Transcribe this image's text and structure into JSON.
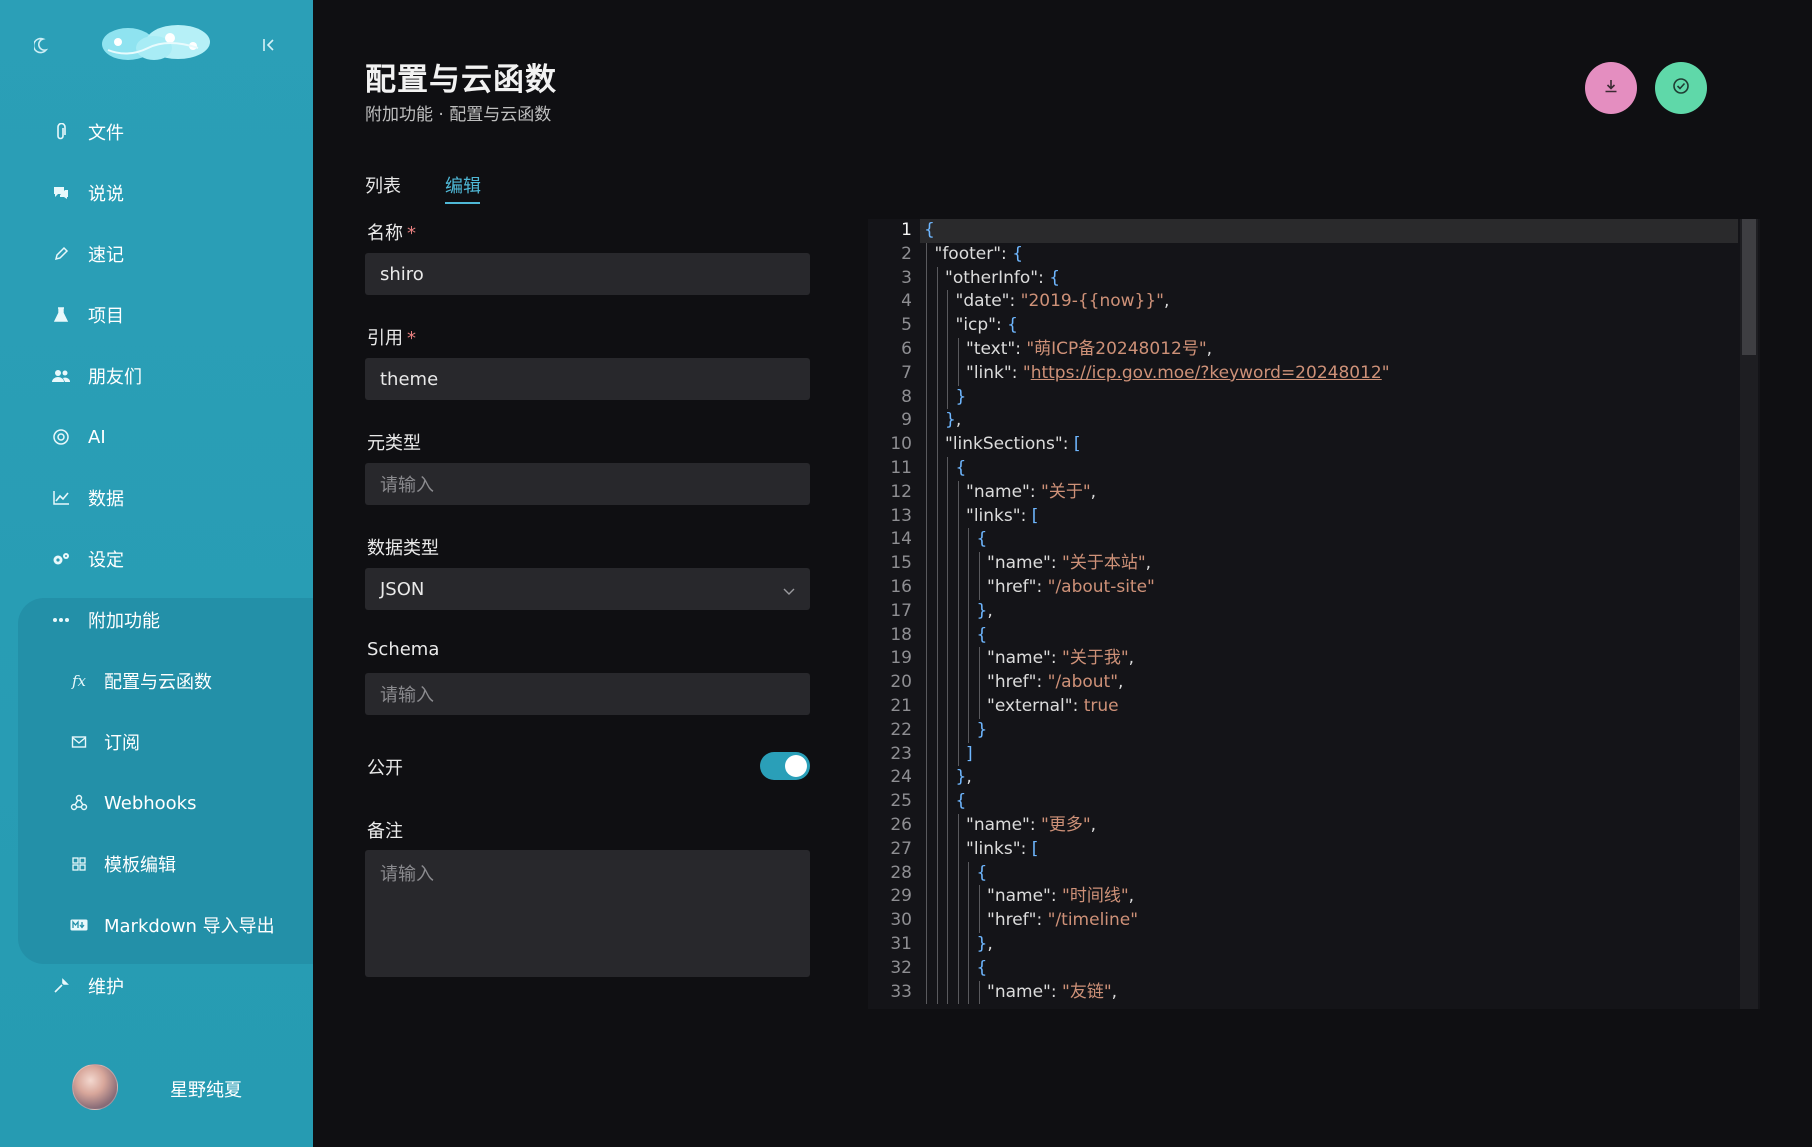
{
  "sidebar": {
    "items": [
      {
        "label": "文件",
        "icon": "paperclip-icon"
      },
      {
        "label": "说说",
        "icon": "chat-icon"
      },
      {
        "label": "速记",
        "icon": "pencil-icon"
      },
      {
        "label": "项目",
        "icon": "flask-icon"
      },
      {
        "label": "朋友们",
        "icon": "people-icon"
      },
      {
        "label": "AI",
        "icon": "ai-icon"
      },
      {
        "label": "数据",
        "icon": "chart-icon"
      },
      {
        "label": "设定",
        "icon": "gears-icon"
      },
      {
        "label": "附加功能",
        "icon": "more-icon"
      }
    ],
    "sub_items": [
      {
        "label": "配置与云函数",
        "icon": "function-icon"
      },
      {
        "label": "订阅",
        "icon": "mail-icon"
      },
      {
        "label": "Webhooks",
        "icon": "webhook-icon"
      },
      {
        "label": "模板编辑",
        "icon": "grid-icon"
      },
      {
        "label": "Markdown 导入导出",
        "icon": "markdown-icon"
      }
    ],
    "maintain": {
      "label": "维护",
      "icon": "wrench-icon"
    },
    "user": {
      "name": "星野纯夏"
    }
  },
  "header": {
    "title": "配置与云函数",
    "breadcrumb": "附加功能 · 配置与云函数"
  },
  "tabs": [
    {
      "label": "列表",
      "active": false
    },
    {
      "label": "编辑",
      "active": true
    }
  ],
  "form": {
    "name_label": "名称",
    "name_value": "shiro",
    "ref_label": "引用",
    "ref_value": "theme",
    "meta_label": "元类型",
    "meta_placeholder": "请输入",
    "datatype_label": "数据类型",
    "datatype_value": "JSON",
    "schema_label": "Schema",
    "schema_placeholder": "请输入",
    "public_label": "公开",
    "public_on": true,
    "remark_label": "备注",
    "remark_placeholder": "请输入",
    "required_mark": "*"
  },
  "editor": {
    "line_numbers": [
      "1",
      "2",
      "3",
      "4",
      "5",
      "6",
      "7",
      "8",
      "9",
      "10",
      "11",
      "12",
      "13",
      "14",
      "15",
      "16",
      "17",
      "18",
      "19",
      "20",
      "21",
      "22",
      "23",
      "24",
      "25",
      "26",
      "27",
      "28",
      "29",
      "30",
      "31",
      "32",
      "33"
    ],
    "lines": [
      {
        "indent": 0,
        "parts": [
          [
            "b",
            "{"
          ]
        ]
      },
      {
        "indent": 1,
        "parts": [
          [
            "k",
            "\"footer\""
          ],
          [
            "k",
            ": "
          ],
          [
            "b",
            "{"
          ]
        ]
      },
      {
        "indent": 2,
        "parts": [
          [
            "k",
            "\"otherInfo\""
          ],
          [
            "k",
            ": "
          ],
          [
            "b",
            "{"
          ]
        ]
      },
      {
        "indent": 3,
        "parts": [
          [
            "k",
            "\"date\""
          ],
          [
            "k",
            ": "
          ],
          [
            "s",
            "\"2019-{{now}}\""
          ],
          [
            "k",
            ","
          ]
        ]
      },
      {
        "indent": 3,
        "parts": [
          [
            "k",
            "\"icp\""
          ],
          [
            "k",
            ": "
          ],
          [
            "b",
            "{"
          ]
        ]
      },
      {
        "indent": 4,
        "parts": [
          [
            "k",
            "\"text\""
          ],
          [
            "k",
            ": "
          ],
          [
            "s",
            "\"萌ICP备20248012号\""
          ],
          [
            "k",
            ","
          ]
        ]
      },
      {
        "indent": 4,
        "parts": [
          [
            "k",
            "\"link\""
          ],
          [
            "k",
            ": "
          ],
          [
            "s",
            "\""
          ],
          [
            "link",
            "https://icp.gov.moe/?keyword=20248012"
          ],
          [
            "s",
            "\""
          ]
        ]
      },
      {
        "indent": 3,
        "parts": [
          [
            "b",
            "}"
          ]
        ]
      },
      {
        "indent": 2,
        "parts": [
          [
            "b",
            "}"
          ],
          [
            "k",
            ","
          ]
        ]
      },
      {
        "indent": 2,
        "parts": [
          [
            "k",
            "\"linkSections\""
          ],
          [
            "k",
            ": "
          ],
          [
            "b",
            "["
          ]
        ]
      },
      {
        "indent": 3,
        "parts": [
          [
            "b",
            "{"
          ]
        ]
      },
      {
        "indent": 4,
        "parts": [
          [
            "k",
            "\"name\""
          ],
          [
            "k",
            ": "
          ],
          [
            "s",
            "\"关于\""
          ],
          [
            "k",
            ","
          ]
        ]
      },
      {
        "indent": 4,
        "parts": [
          [
            "k",
            "\"links\""
          ],
          [
            "k",
            ": "
          ],
          [
            "b",
            "["
          ]
        ]
      },
      {
        "indent": 5,
        "parts": [
          [
            "b",
            "{"
          ]
        ]
      },
      {
        "indent": 6,
        "parts": [
          [
            "k",
            "\"name\""
          ],
          [
            "k",
            ": "
          ],
          [
            "s",
            "\"关于本站\""
          ],
          [
            "k",
            ","
          ]
        ]
      },
      {
        "indent": 6,
        "parts": [
          [
            "k",
            "\"href\""
          ],
          [
            "k",
            ": "
          ],
          [
            "s",
            "\"/about-site\""
          ]
        ]
      },
      {
        "indent": 5,
        "parts": [
          [
            "b",
            "}"
          ],
          [
            "k",
            ","
          ]
        ]
      },
      {
        "indent": 5,
        "parts": [
          [
            "b",
            "{"
          ]
        ]
      },
      {
        "indent": 6,
        "parts": [
          [
            "k",
            "\"name\""
          ],
          [
            "k",
            ": "
          ],
          [
            "s",
            "\"关于我\""
          ],
          [
            "k",
            ","
          ]
        ]
      },
      {
        "indent": 6,
        "parts": [
          [
            "k",
            "\"href\""
          ],
          [
            "k",
            ": "
          ],
          [
            "s",
            "\"/about\""
          ],
          [
            "k",
            ","
          ]
        ]
      },
      {
        "indent": 6,
        "parts": [
          [
            "k",
            "\"external\""
          ],
          [
            "k",
            ": "
          ],
          [
            "s",
            "true"
          ]
        ]
      },
      {
        "indent": 5,
        "parts": [
          [
            "b",
            "}"
          ]
        ]
      },
      {
        "indent": 4,
        "parts": [
          [
            "b",
            "]"
          ]
        ]
      },
      {
        "indent": 3,
        "parts": [
          [
            "b",
            "}"
          ],
          [
            "k",
            ","
          ]
        ]
      },
      {
        "indent": 3,
        "parts": [
          [
            "b",
            "{"
          ]
        ]
      },
      {
        "indent": 4,
        "parts": [
          [
            "k",
            "\"name\""
          ],
          [
            "k",
            ": "
          ],
          [
            "s",
            "\"更多\""
          ],
          [
            "k",
            ","
          ]
        ]
      },
      {
        "indent": 4,
        "parts": [
          [
            "k",
            "\"links\""
          ],
          [
            "k",
            ": "
          ],
          [
            "b",
            "["
          ]
        ]
      },
      {
        "indent": 5,
        "parts": [
          [
            "b",
            "{"
          ]
        ]
      },
      {
        "indent": 6,
        "parts": [
          [
            "k",
            "\"name\""
          ],
          [
            "k",
            ": "
          ],
          [
            "s",
            "\"时间线\""
          ],
          [
            "k",
            ","
          ]
        ]
      },
      {
        "indent": 6,
        "parts": [
          [
            "k",
            "\"href\""
          ],
          [
            "k",
            ": "
          ],
          [
            "s",
            "\"/timeline\""
          ]
        ]
      },
      {
        "indent": 5,
        "parts": [
          [
            "b",
            "}"
          ],
          [
            "k",
            ","
          ]
        ]
      },
      {
        "indent": 5,
        "parts": [
          [
            "b",
            "{"
          ]
        ]
      },
      {
        "indent": 6,
        "parts": [
          [
            "k",
            "\"name\""
          ],
          [
            "k",
            ": "
          ],
          [
            "s",
            "\"友链\""
          ],
          [
            "k",
            ","
          ]
        ]
      }
    ]
  },
  "colors": {
    "sidebar": "#2a9cb4",
    "accent": "#4fb8d6",
    "download_button": "#e48ec0",
    "confirm_button": "#5fd8a9",
    "string": "#ce9178",
    "bracket": "#6fb7ff"
  }
}
